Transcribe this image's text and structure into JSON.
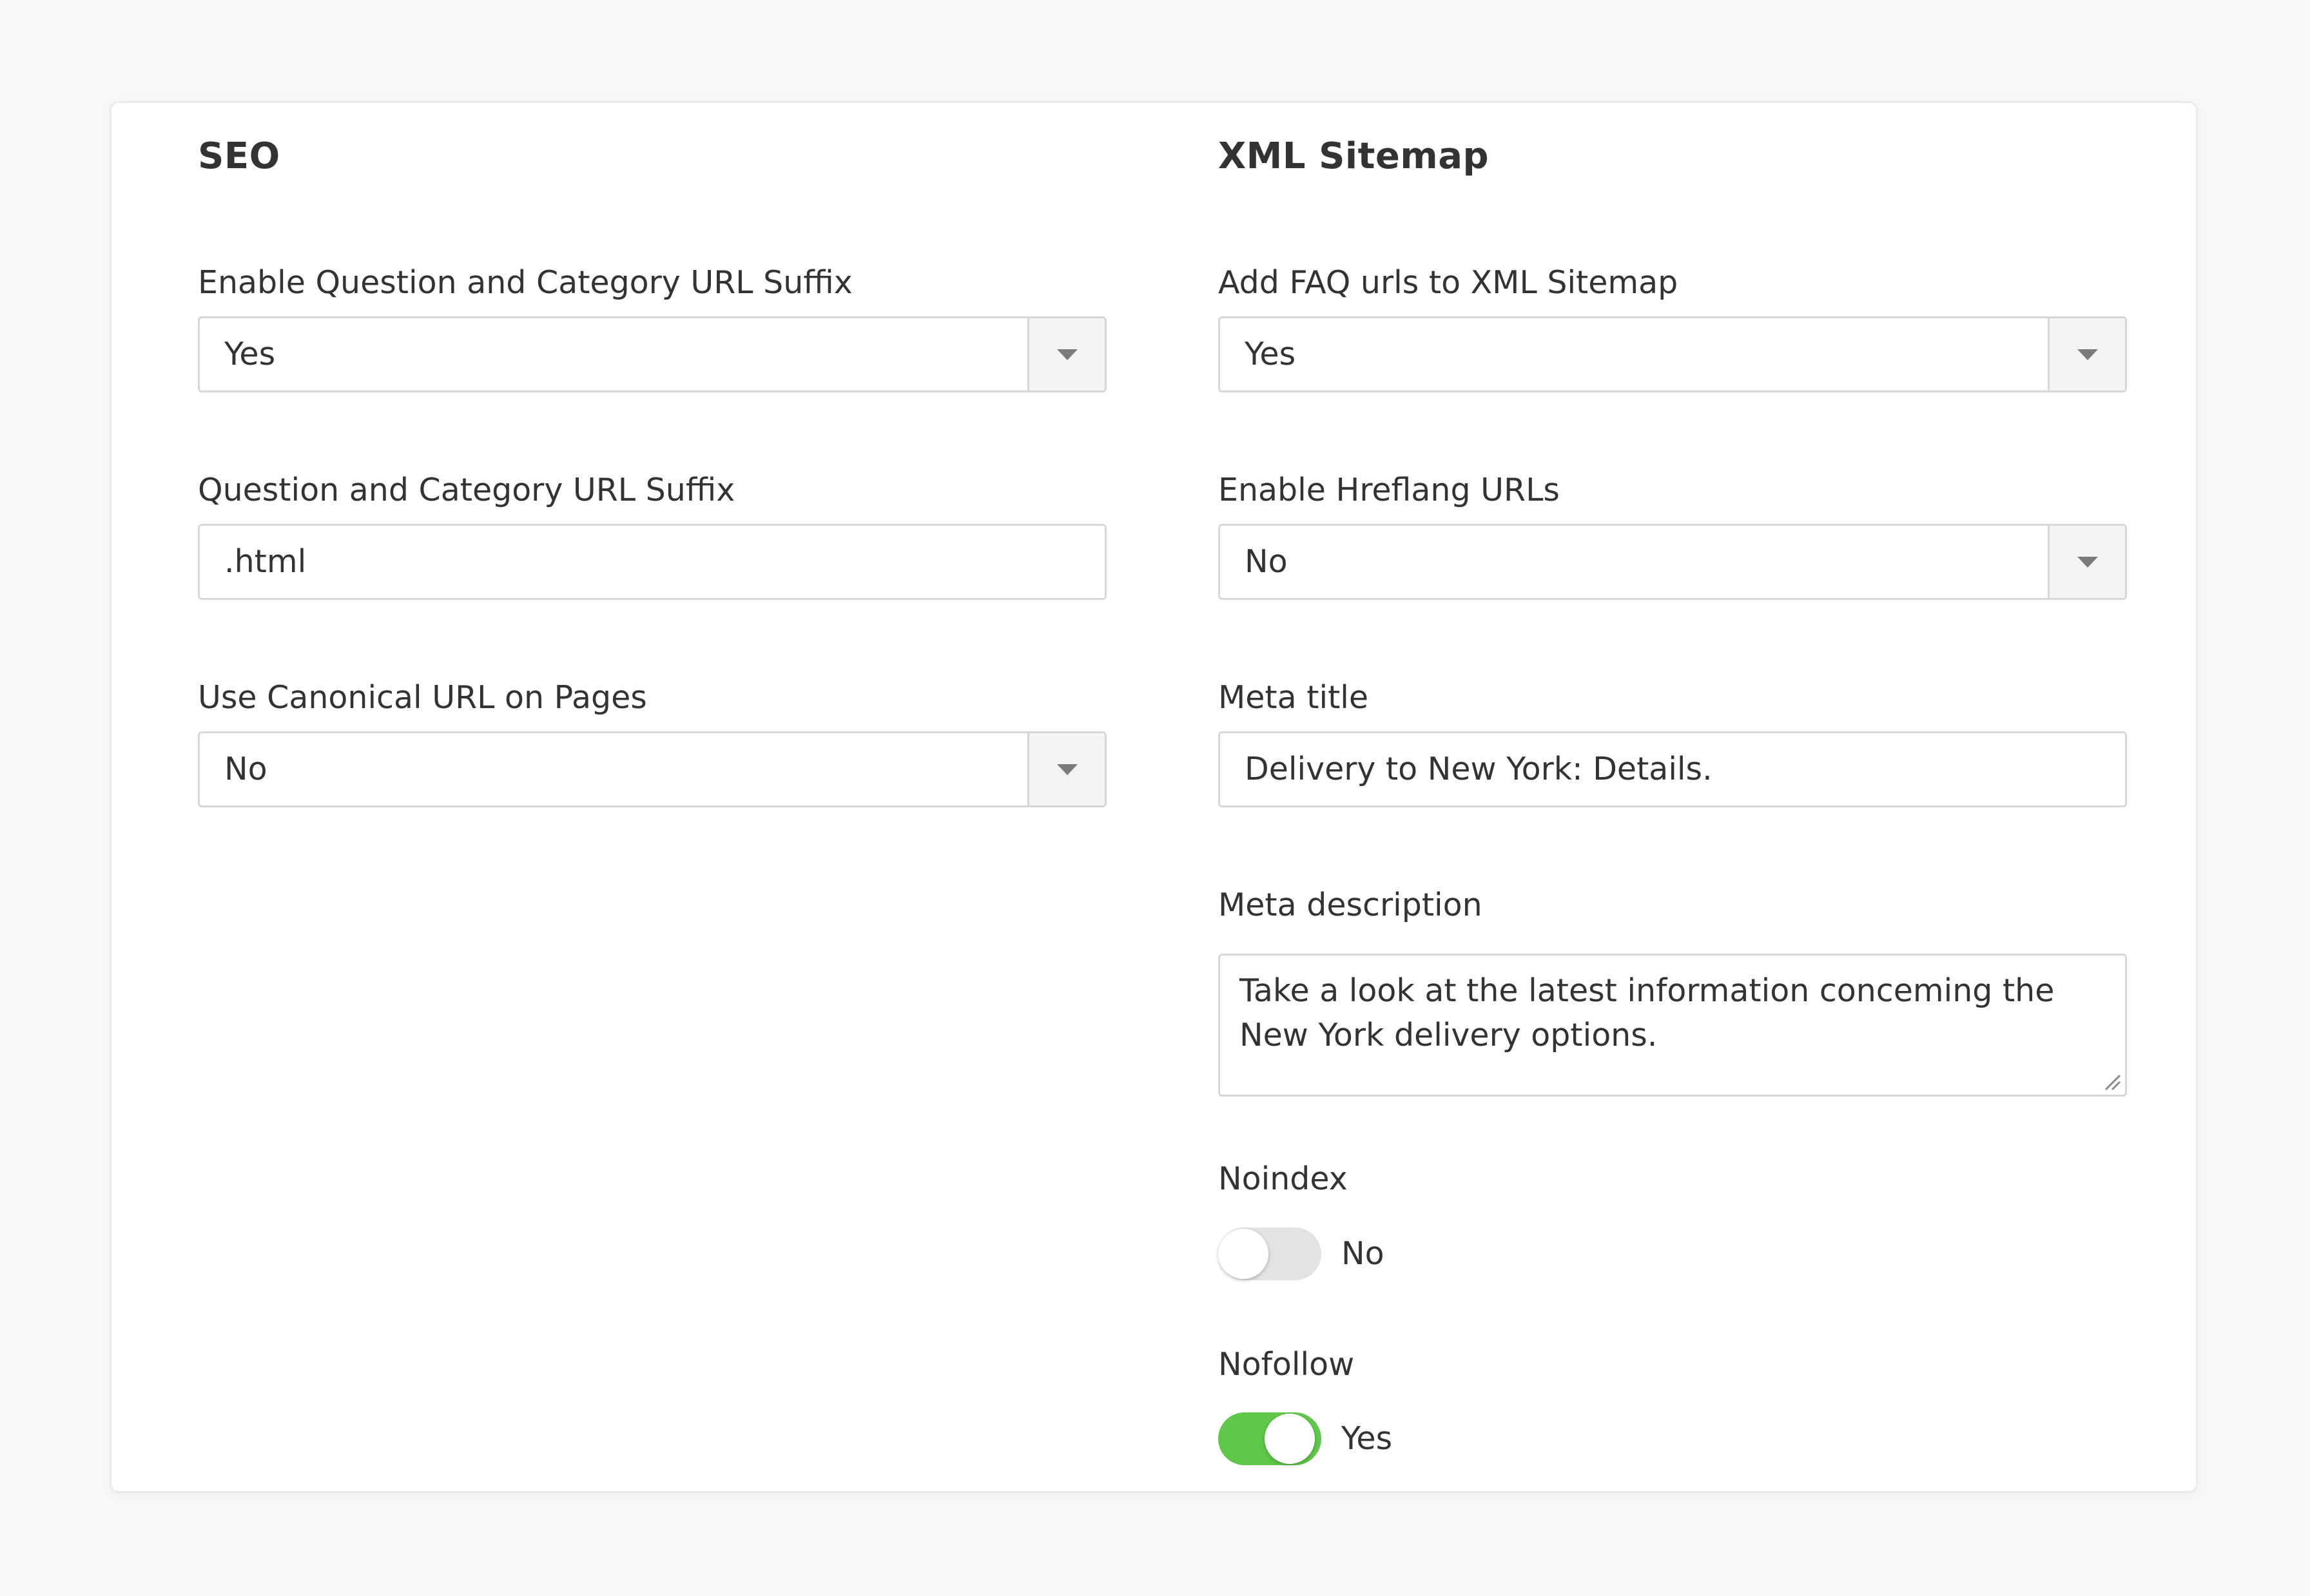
{
  "seo": {
    "title": "SEO",
    "fields": [
      {
        "label": "Enable Question and Category URL Suffix",
        "value": "Yes"
      },
      {
        "label": "Question and Category URL Suffix",
        "value": ".html"
      },
      {
        "label": "Use Canonical URL on Pages",
        "value": "No"
      }
    ]
  },
  "sitemap": {
    "title": "XML Sitemap",
    "add_faq": {
      "label": "Add FAQ urls to XML Sitemap",
      "value": "Yes"
    },
    "hreflang": {
      "label": "Enable Hreflang URLs",
      "value": "No"
    },
    "meta_title": {
      "label": "Meta title",
      "value": "Delivery to New York: Details."
    },
    "meta_description": {
      "label": "Meta description",
      "value": "Take a look at the latest information conceming the New York delivery options."
    },
    "noindex": {
      "label": "Noindex",
      "state_label": "No",
      "on": false
    },
    "nofollow": {
      "label": "Nofollow",
      "state_label": "Yes",
      "on": true
    }
  },
  "colors": {
    "toggle_on": "#5fc84a",
    "toggle_off": "#e3e3e5",
    "border": "#d7d7da"
  },
  "icons": {
    "dropdown": "chevron-down-icon",
    "resize": "resize-grip-icon"
  }
}
